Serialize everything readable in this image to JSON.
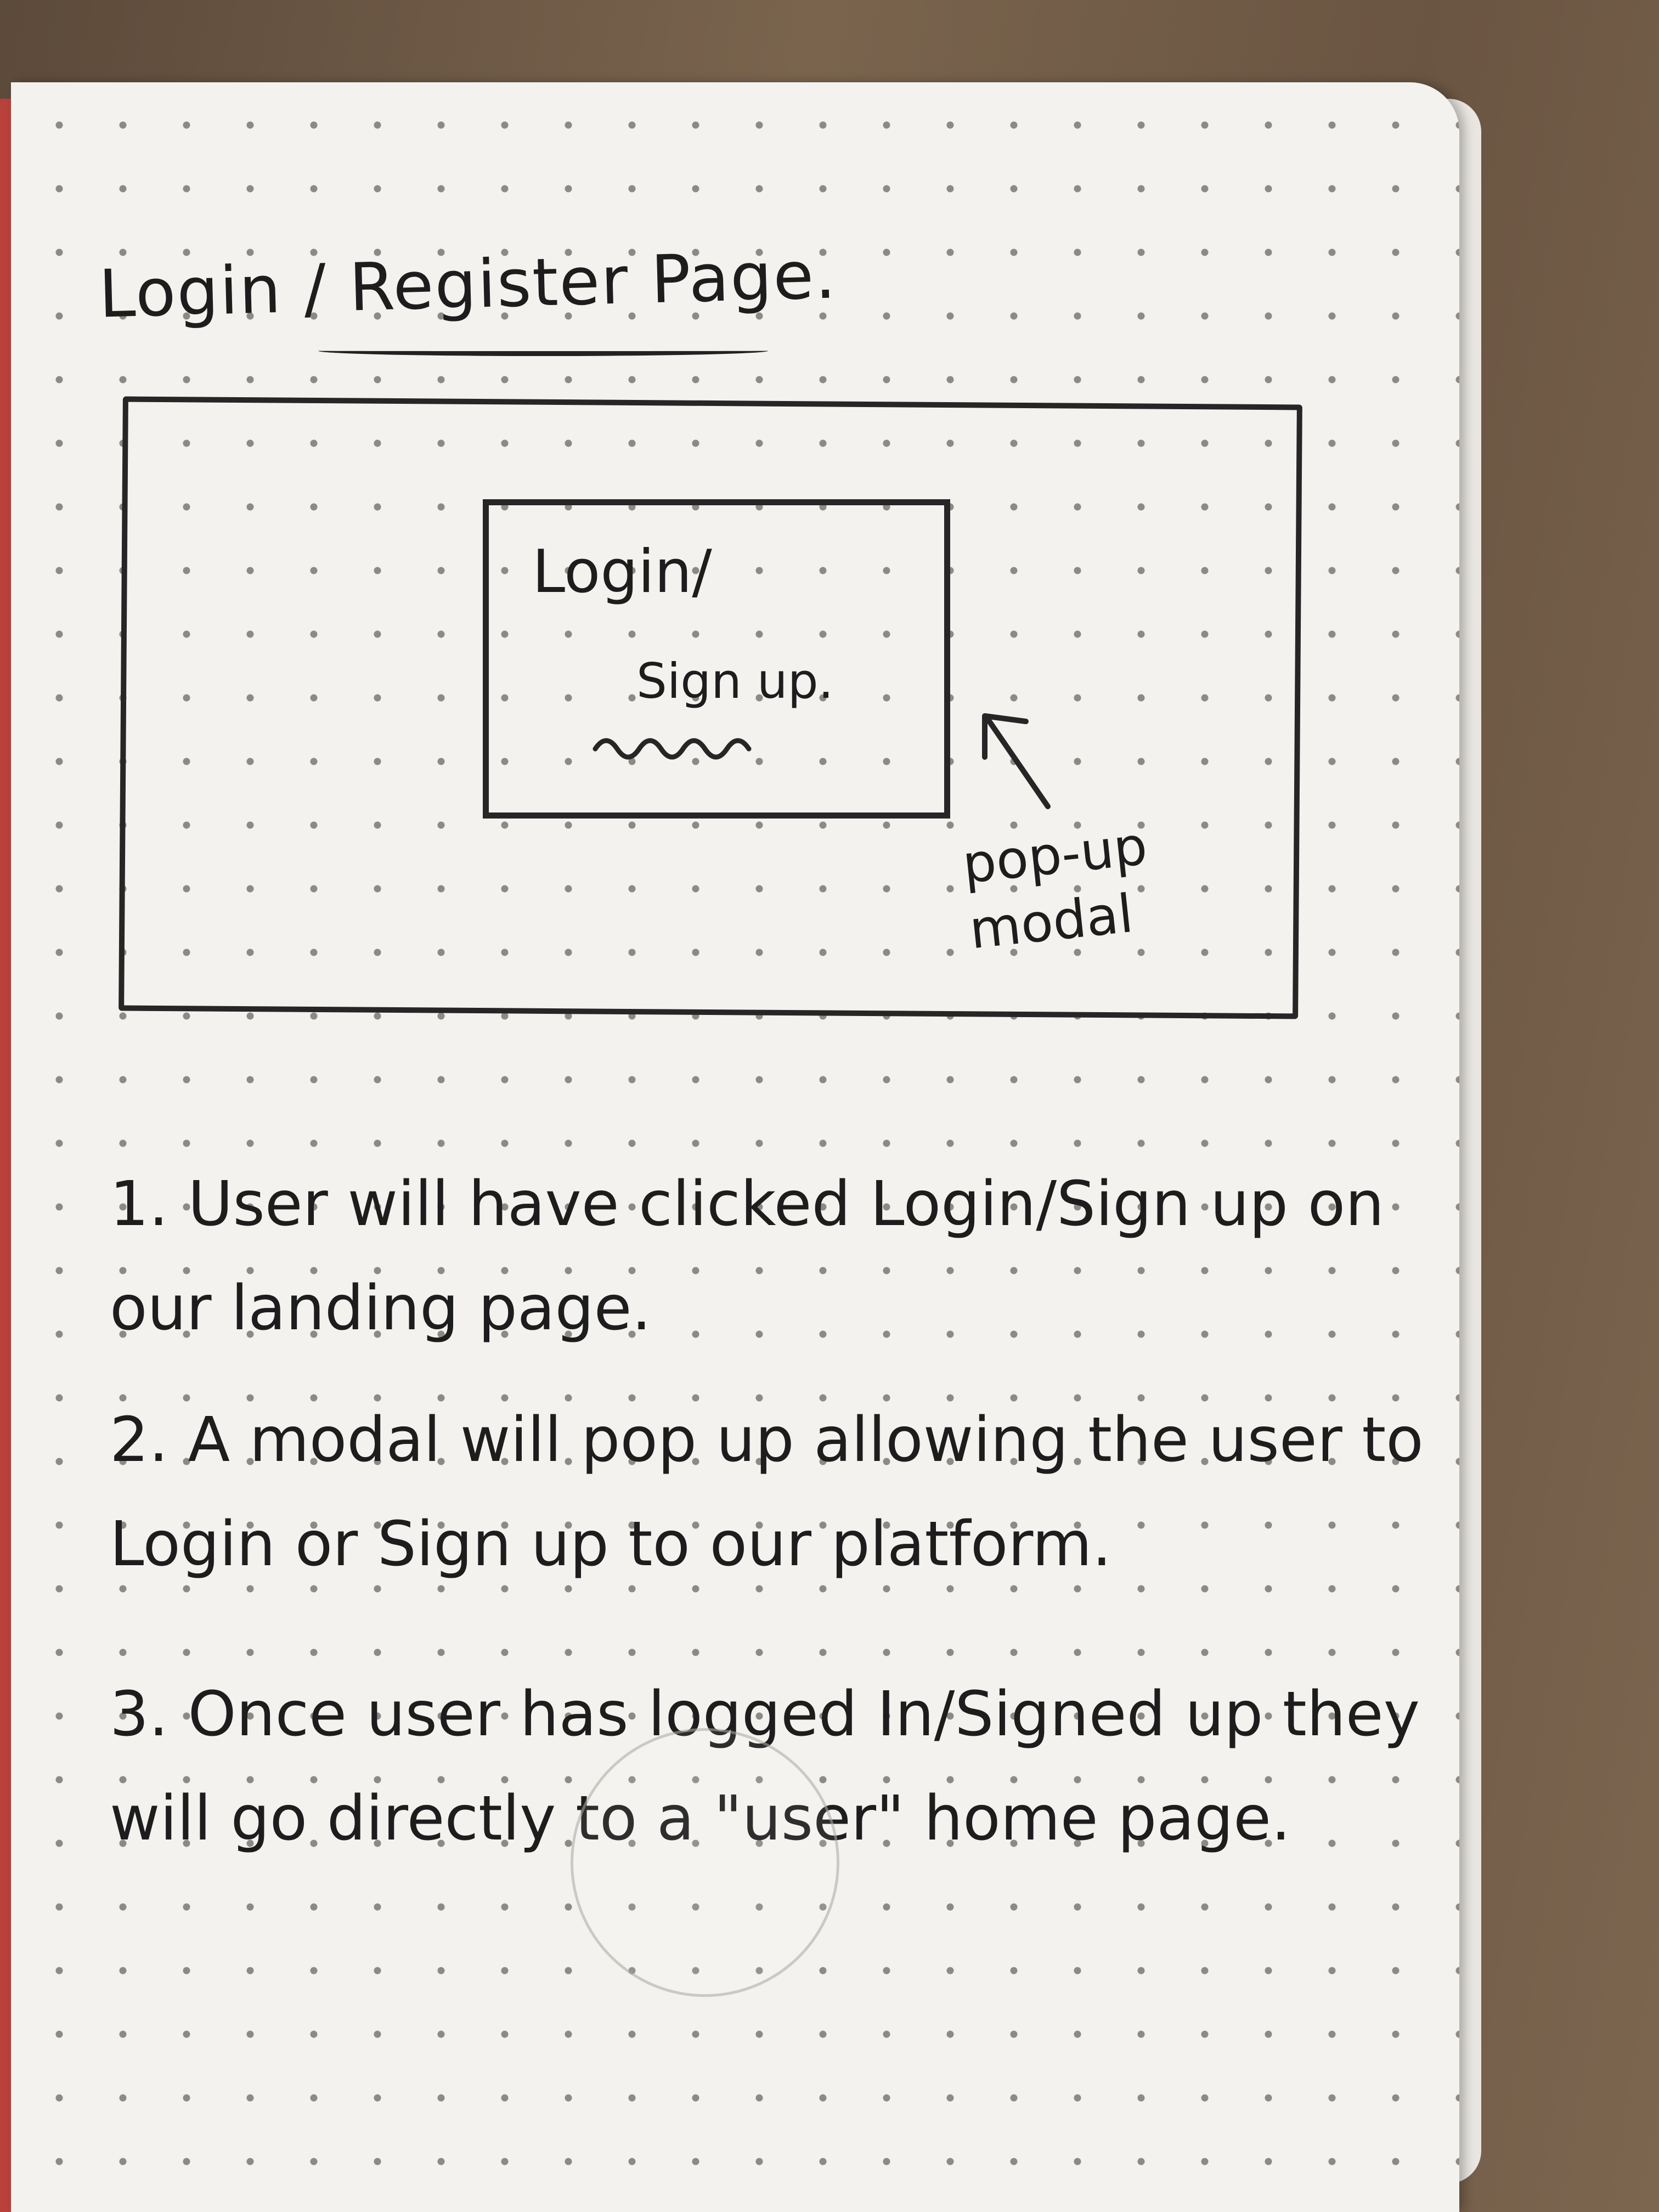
{
  "page_title": "Login / Register Page.",
  "wireframe": {
    "modal_title": "Login/",
    "modal_subtitle": "Sign up.",
    "annotation": "pop-up modal"
  },
  "steps": [
    "1. User will have clicked Login/Sign up on our landing page.",
    "2. A modal will pop up allowing the user to Login or Sign up to our platform.",
    "3. Once user has logged In/Signed up they will go directly to a \"user\" home page."
  ]
}
